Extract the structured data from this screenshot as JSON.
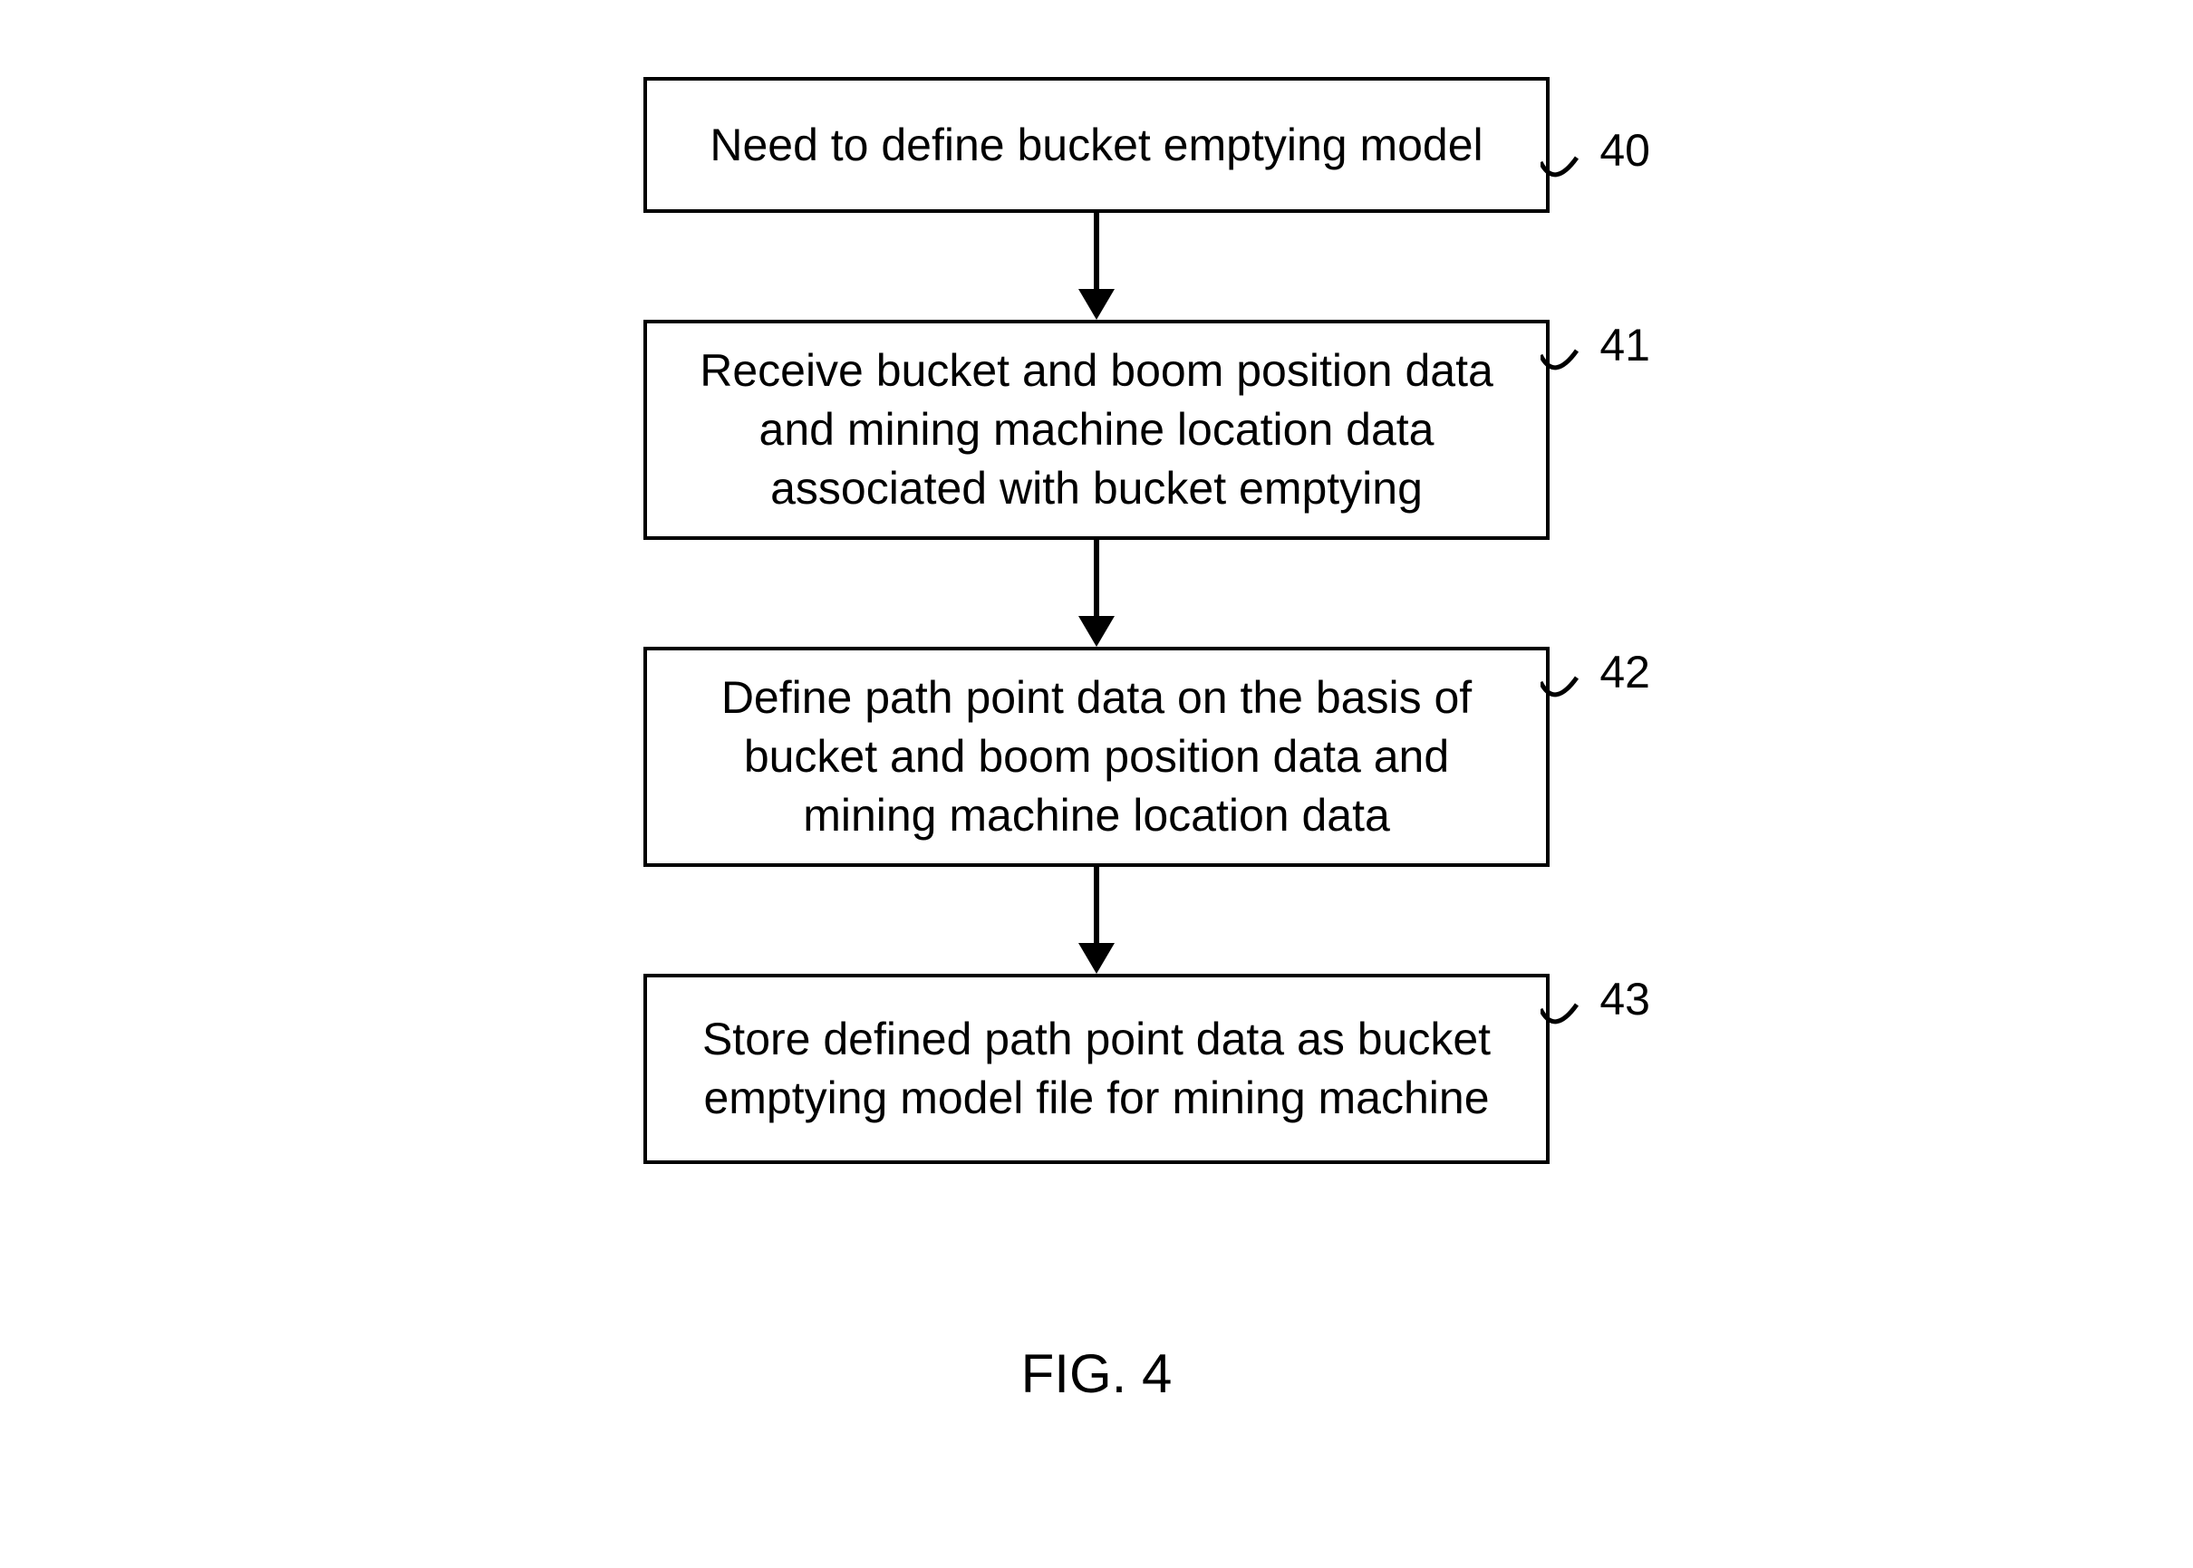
{
  "flowchart": {
    "boxes": [
      {
        "text": "Need to define bucket emptying model",
        "label": "40"
      },
      {
        "text": "Receive bucket and boom position data and mining machine location data associated with bucket emptying",
        "label": "41"
      },
      {
        "text": "Define path point data on the basis of bucket and boom position data and mining machine location data",
        "label": "42"
      },
      {
        "text": "Store defined path point data as bucket emptying model file for mining machine",
        "label": "43"
      }
    ]
  },
  "caption": "FIG. 4"
}
